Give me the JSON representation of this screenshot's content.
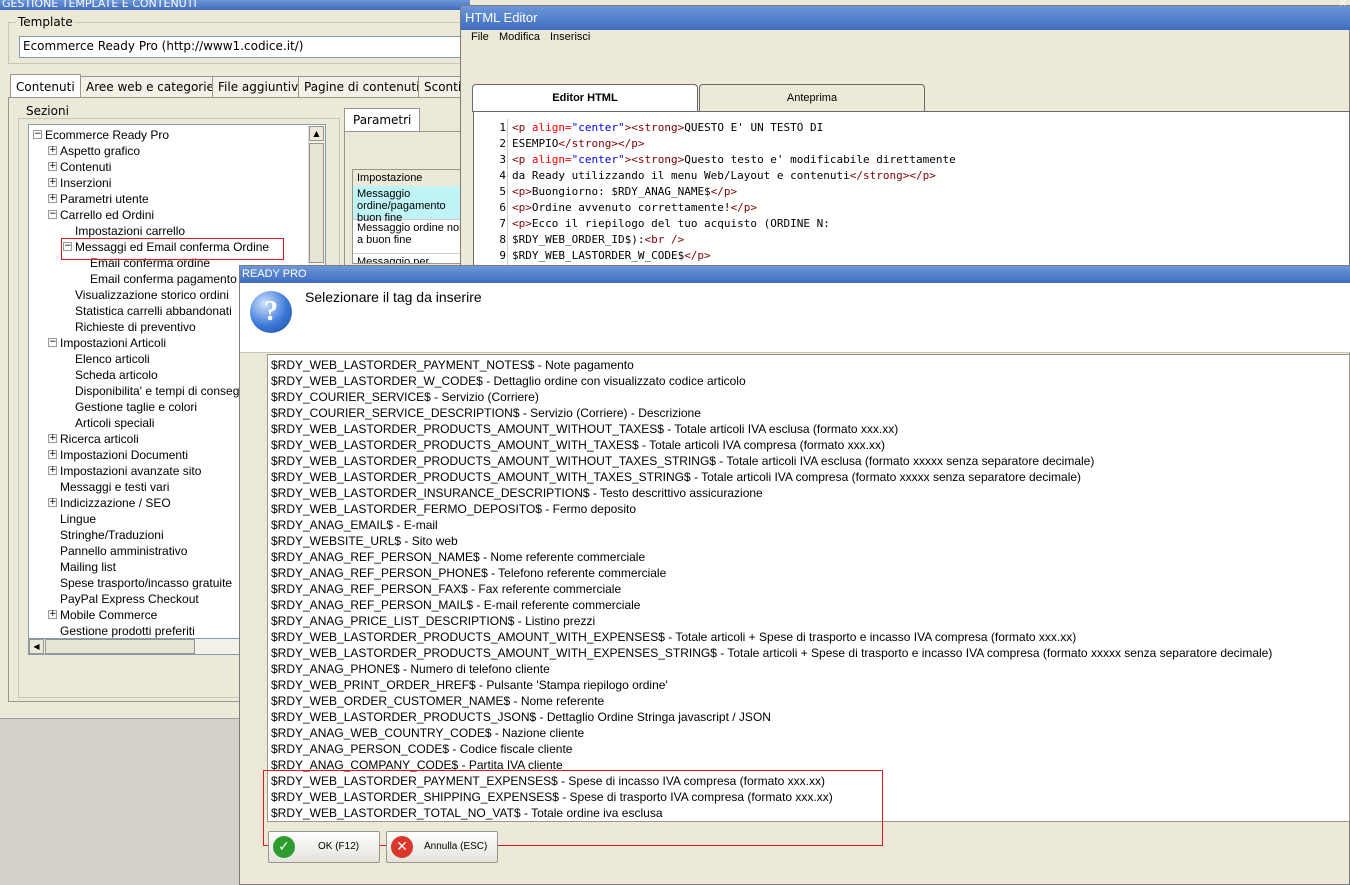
{
  "main_window": {
    "title": "GESTIONE TEMPLATE E CONTENUTI",
    "template_label": "Template",
    "template_value": "Ecommerce Ready Pro (http://www1.codice.it/)",
    "tabs": [
      "Contenuti",
      "Aree web e categorie",
      "File aggiuntivi",
      "Pagine di contenuti",
      "Sconti"
    ],
    "sections_label": "Sezioni",
    "tree": [
      {
        "label": "Ecommerce Ready Pro",
        "level": 0,
        "expander": "−"
      },
      {
        "label": "Aspetto grafico",
        "level": 1,
        "expander": "+"
      },
      {
        "label": "Contenuti",
        "level": 1,
        "expander": "+"
      },
      {
        "label": "Inserzioni",
        "level": 1,
        "expander": "+"
      },
      {
        "label": "Parametri utente",
        "level": 1,
        "expander": "+"
      },
      {
        "label": "Carrello ed Ordini",
        "level": 1,
        "expander": "−"
      },
      {
        "label": "Impostazioni carrello",
        "level": 2,
        "expander": ""
      },
      {
        "label": "Messaggi ed Email conferma Ordine",
        "level": 2,
        "expander": "−"
      },
      {
        "label": "Email conferma ordine",
        "level": 3,
        "expander": ""
      },
      {
        "label": "Email conferma pagamento",
        "level": 3,
        "expander": ""
      },
      {
        "label": "Visualizzazione storico ordini",
        "level": 2,
        "expander": ""
      },
      {
        "label": "Statistica carrelli abbandonati",
        "level": 2,
        "expander": ""
      },
      {
        "label": "Richieste di preventivo",
        "level": 2,
        "expander": ""
      },
      {
        "label": "Impostazioni Articoli",
        "level": 1,
        "expander": "−"
      },
      {
        "label": "Elenco articoli",
        "level": 2,
        "expander": ""
      },
      {
        "label": "Scheda articolo",
        "level": 2,
        "expander": ""
      },
      {
        "label": "Disponibilita' e tempi di consegna",
        "level": 2,
        "expander": ""
      },
      {
        "label": "Gestione taglie e colori",
        "level": 2,
        "expander": ""
      },
      {
        "label": "Articoli speciali",
        "level": 2,
        "expander": ""
      },
      {
        "label": "Ricerca articoli",
        "level": 1,
        "expander": "+"
      },
      {
        "label": "Impostazioni Documenti",
        "level": 1,
        "expander": "+"
      },
      {
        "label": "Impostazioni avanzate sito",
        "level": 1,
        "expander": "+"
      },
      {
        "label": "Messaggi e testi vari",
        "level": 1,
        "expander": ""
      },
      {
        "label": "Indicizzazione / SEO",
        "level": 1,
        "expander": "+"
      },
      {
        "label": "Lingue",
        "level": 1,
        "expander": ""
      },
      {
        "label": "Stringhe/Traduzioni",
        "level": 1,
        "expander": ""
      },
      {
        "label": "Pannello amministrativo",
        "level": 1,
        "expander": ""
      },
      {
        "label": "Mailing list",
        "level": 1,
        "expander": ""
      },
      {
        "label": "Spese trasporto/incasso gratuite",
        "level": 1,
        "expander": ""
      },
      {
        "label": "PayPal Express Checkout",
        "level": 1,
        "expander": ""
      },
      {
        "label": "Mobile Commerce",
        "level": 1,
        "expander": "+"
      },
      {
        "label": "Gestione prodotti preferiti",
        "level": 1,
        "expander": ""
      }
    ],
    "params_tab": "Parametri",
    "params_header": "Impostazione",
    "params_rows": [
      "Messaggio ordine/pagamento buon fine",
      "Messaggio ordine non a buon fine",
      "Messaggio per pagamento"
    ]
  },
  "editor": {
    "title": "HTML Editor",
    "close_glyph": "×",
    "menu": [
      "File",
      "Modifica",
      "Inserisci"
    ],
    "tabs": [
      "Editor HTML",
      "Anteprima"
    ],
    "lines": [
      {
        "n": "1",
        "parts": [
          [
            "tag",
            "<p "
          ],
          [
            "attr",
            "align="
          ],
          [
            "val",
            "\"center\""
          ],
          [
            "tag",
            "><strong>"
          ],
          [
            "txt",
            "QUESTO E' UN TESTO DI"
          ]
        ]
      },
      {
        "n": "2",
        "parts": [
          [
            "txt",
            "ESEMPIO"
          ],
          [
            "tag",
            "</strong></p>"
          ]
        ]
      },
      {
        "n": "3",
        "parts": [
          [
            "tag",
            "<p "
          ],
          [
            "attr",
            "align="
          ],
          [
            "val",
            "\"center\""
          ],
          [
            "tag",
            "><strong>"
          ],
          [
            "txt",
            "Questo testo e' modificabile direttamente"
          ]
        ]
      },
      {
        "n": "4",
        "parts": [
          [
            "txt",
            "da Ready utilizzando il menu Web/Layout e contenuti"
          ],
          [
            "tag",
            "</strong></p>"
          ]
        ]
      },
      {
        "n": "5",
        "parts": [
          [
            "tag",
            "<p>"
          ],
          [
            "txt",
            "Buongiorno: $RDY_ANAG_NAME$"
          ],
          [
            "tag",
            "</p>"
          ]
        ]
      },
      {
        "n": "6",
        "parts": [
          [
            "tag",
            "<p>"
          ],
          [
            "txt",
            "Ordine avvenuto correttamente!"
          ],
          [
            "tag",
            "</p>"
          ]
        ]
      },
      {
        "n": "7",
        "parts": [
          [
            "tag",
            "<p>"
          ],
          [
            "txt",
            "Ecco il riepilogo del tuo acquisto (ORDINE N:"
          ]
        ]
      },
      {
        "n": "8",
        "parts": [
          [
            "txt",
            "$RDY_WEB_ORDER_ID$):"
          ],
          [
            "tag",
            "<br />"
          ]
        ]
      },
      {
        "n": "9",
        "parts": [
          [
            "txt",
            "$RDY_WEB_LASTORDER_W_CODE$"
          ],
          [
            "tag",
            "</p>"
          ]
        ]
      }
    ]
  },
  "dialog": {
    "title": "READY PRO",
    "prompt": "Selezionare il tag da inserire",
    "icon_glyph": "?",
    "items": [
      "$RDY_WEB_LASTORDER_PAYMENT_NOTES$ - Note pagamento",
      "$RDY_WEB_LASTORDER_W_CODE$ - Dettaglio ordine con visualizzato codice articolo",
      "$RDY_COURIER_SERVICE$ - Servizio (Corriere)",
      "$RDY_COURIER_SERVICE_DESCRIPTION$ - Servizio (Corriere) - Descrizione",
      "$RDY_WEB_LASTORDER_PRODUCTS_AMOUNT_WITHOUT_TAXES$ - Totale articoli IVA esclusa (formato xxx.xx)",
      "$RDY_WEB_LASTORDER_PRODUCTS_AMOUNT_WITH_TAXES$ - Totale articoli IVA compresa (formato xxx.xx)",
      "$RDY_WEB_LASTORDER_PRODUCTS_AMOUNT_WITHOUT_TAXES_STRING$ - Totale articoli IVA esclusa (formato xxxxx senza separatore decimale)",
      "$RDY_WEB_LASTORDER_PRODUCTS_AMOUNT_WITH_TAXES_STRING$ - Totale articoli IVA compresa (formato xxxxx senza separatore decimale)",
      "$RDY_WEB_LASTORDER_INSURANCE_DESCRIPTION$ - Testo descrittivo assicurazione",
      "$RDY_WEB_LASTORDER_FERMO_DEPOSITO$ - Fermo deposito",
      "$RDY_ANAG_EMAIL$ - E-mail",
      "$RDY_WEBSITE_URL$ - Sito web",
      "$RDY_ANAG_REF_PERSON_NAME$ - Nome referente commerciale",
      "$RDY_ANAG_REF_PERSON_PHONE$ - Telefono referente commerciale",
      "$RDY_ANAG_REF_PERSON_FAX$ - Fax referente commerciale",
      "$RDY_ANAG_REF_PERSON_MAIL$ - E-mail referente commerciale",
      "$RDY_ANAG_PRICE_LIST_DESCRIPTION$ - Listino prezzi",
      "$RDY_WEB_LASTORDER_PRODUCTS_AMOUNT_WITH_EXPENSES$ - Totale articoli + Spese di trasporto e incasso IVA compresa (formato xxx.xx)",
      "$RDY_WEB_LASTORDER_PRODUCTS_AMOUNT_WITH_EXPENSES_STRING$ - Totale articoli + Spese di trasporto e incasso IVA compresa (formato xxxxx senza separatore decimale)",
      "$RDY_ANAG_PHONE$ - Numero di telefono cliente",
      "$RDY_WEB_PRINT_ORDER_HREF$ - Pulsante 'Stampa riepilogo ordine'",
      "$RDY_WEB_ORDER_CUSTOMER_NAME$ - Nome referente",
      "$RDY_WEB_LASTORDER_PRODUCTS_JSON$ - Dettaglio Ordine Stringa javascript / JSON",
      "$RDY_ANAG_WEB_COUNTRY_CODE$ - Nazione cliente",
      "$RDY_ANAG_PERSON_CODE$ - Codice fiscale cliente",
      "$RDY_ANAG_COMPANY_CODE$ - Partita IVA cliente",
      "$RDY_WEB_LASTORDER_PAYMENT_EXPENSES$ - Spese di incasso IVA compresa (formato xxx.xx)",
      "$RDY_WEB_LASTORDER_SHIPPING_EXPENSES$ - Spese di trasporto IVA compresa (formato xxx.xx)",
      "$RDY_WEB_LASTORDER_TOTAL_NO_VAT$ - Totale ordine iva esclusa"
    ],
    "ok_label": "OK (F12)",
    "cancel_label": "Annulla (ESC)"
  },
  "colors": {
    "titlebar": "#3e6cc0",
    "highlight_box": "#e0191f",
    "tag": "#800000",
    "attr": "#ff0000",
    "value": "#0000ff",
    "ok_icon": "#2e9b2e",
    "cancel_icon": "#d9372b"
  }
}
